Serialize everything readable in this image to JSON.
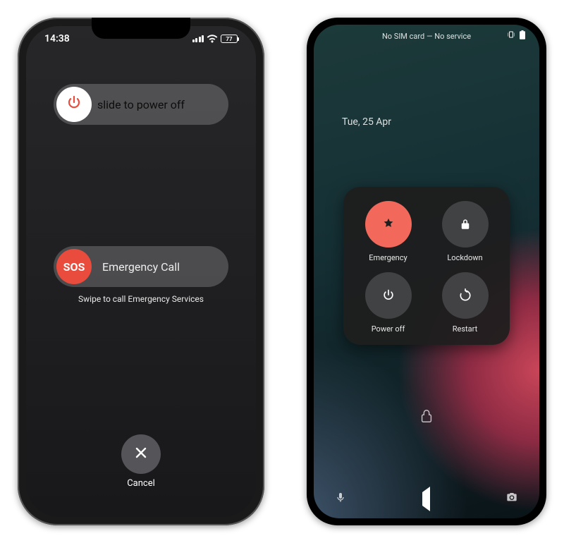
{
  "iphone": {
    "status": {
      "time": "14:38",
      "battery_pct": "77"
    },
    "power_slider": {
      "label": "slide to power off"
    },
    "emergency_slider": {
      "knob_label": "SOS",
      "label": "Emergency Call",
      "hint": "Swipe to call Emergency Services"
    },
    "cancel_label": "Cancel"
  },
  "android": {
    "status": {
      "sim_text": "No SIM card — No service"
    },
    "date": "Tue, 25 Apr",
    "power_menu": {
      "emergency": "Emergency",
      "lockdown": "Lockdown",
      "power_off": "Power off",
      "restart": "Restart"
    }
  }
}
